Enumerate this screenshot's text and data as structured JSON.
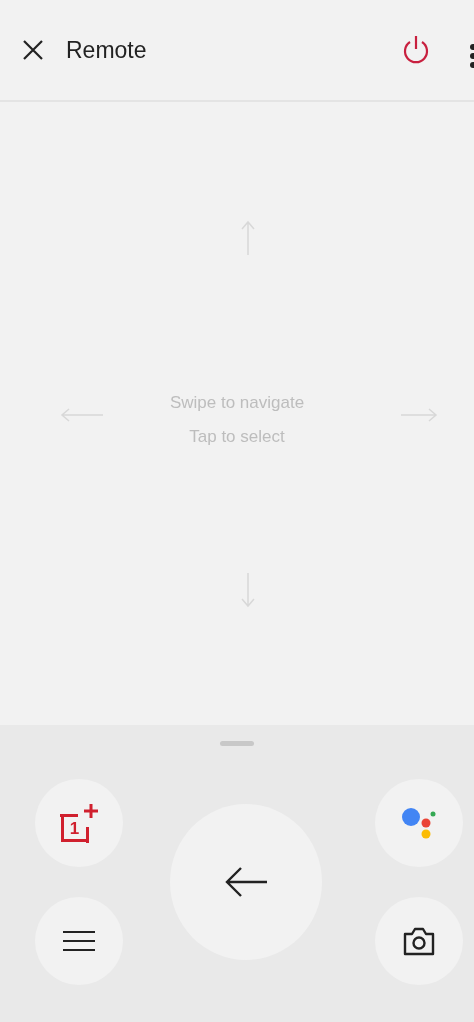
{
  "header": {
    "title": "Remote"
  },
  "touchpad": {
    "hints": [
      "Swipe to navigate",
      "Tap to select"
    ]
  },
  "buttons": [
    {
      "kind": "brand",
      "text": "1"
    },
    {
      "kind": "menu"
    },
    {
      "kind": "back"
    },
    {
      "kind": "assistant"
    },
    {
      "kind": "camera"
    }
  ]
}
